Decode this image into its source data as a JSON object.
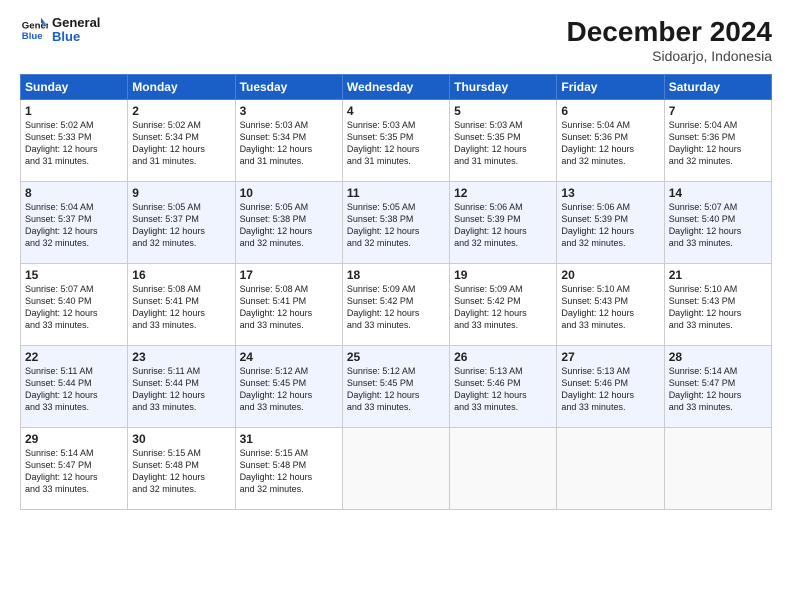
{
  "header": {
    "logo_line1": "General",
    "logo_line2": "Blue",
    "month": "December 2024",
    "location": "Sidoarjo, Indonesia"
  },
  "days_of_week": [
    "Sunday",
    "Monday",
    "Tuesday",
    "Wednesday",
    "Thursday",
    "Friday",
    "Saturday"
  ],
  "weeks": [
    [
      {
        "day": "1",
        "rise": "5:02 AM",
        "set": "5:33 PM",
        "hours": "12",
        "mins": "31"
      },
      {
        "day": "2",
        "rise": "5:02 AM",
        "set": "5:34 PM",
        "hours": "12",
        "mins": "31"
      },
      {
        "day": "3",
        "rise": "5:03 AM",
        "set": "5:34 PM",
        "hours": "12",
        "mins": "31"
      },
      {
        "day": "4",
        "rise": "5:03 AM",
        "set": "5:35 PM",
        "hours": "12",
        "mins": "31"
      },
      {
        "day": "5",
        "rise": "5:03 AM",
        "set": "5:35 PM",
        "hours": "12",
        "mins": "31"
      },
      {
        "day": "6",
        "rise": "5:04 AM",
        "set": "5:36 PM",
        "hours": "12",
        "mins": "32"
      },
      {
        "day": "7",
        "rise": "5:04 AM",
        "set": "5:36 PM",
        "hours": "12",
        "mins": "32"
      }
    ],
    [
      {
        "day": "8",
        "rise": "5:04 AM",
        "set": "5:37 PM",
        "hours": "12",
        "mins": "32"
      },
      {
        "day": "9",
        "rise": "5:05 AM",
        "set": "5:37 PM",
        "hours": "12",
        "mins": "32"
      },
      {
        "day": "10",
        "rise": "5:05 AM",
        "set": "5:38 PM",
        "hours": "12",
        "mins": "32"
      },
      {
        "day": "11",
        "rise": "5:05 AM",
        "set": "5:38 PM",
        "hours": "12",
        "mins": "32"
      },
      {
        "day": "12",
        "rise": "5:06 AM",
        "set": "5:39 PM",
        "hours": "12",
        "mins": "32"
      },
      {
        "day": "13",
        "rise": "5:06 AM",
        "set": "5:39 PM",
        "hours": "12",
        "mins": "32"
      },
      {
        "day": "14",
        "rise": "5:07 AM",
        "set": "5:40 PM",
        "hours": "12",
        "mins": "33"
      }
    ],
    [
      {
        "day": "15",
        "rise": "5:07 AM",
        "set": "5:40 PM",
        "hours": "12",
        "mins": "33"
      },
      {
        "day": "16",
        "rise": "5:08 AM",
        "set": "5:41 PM",
        "hours": "12",
        "mins": "33"
      },
      {
        "day": "17",
        "rise": "5:08 AM",
        "set": "5:41 PM",
        "hours": "12",
        "mins": "33"
      },
      {
        "day": "18",
        "rise": "5:09 AM",
        "set": "5:42 PM",
        "hours": "12",
        "mins": "33"
      },
      {
        "day": "19",
        "rise": "5:09 AM",
        "set": "5:42 PM",
        "hours": "12",
        "mins": "33"
      },
      {
        "day": "20",
        "rise": "5:10 AM",
        "set": "5:43 PM",
        "hours": "12",
        "mins": "33"
      },
      {
        "day": "21",
        "rise": "5:10 AM",
        "set": "5:43 PM",
        "hours": "12",
        "mins": "33"
      }
    ],
    [
      {
        "day": "22",
        "rise": "5:11 AM",
        "set": "5:44 PM",
        "hours": "12",
        "mins": "33"
      },
      {
        "day": "23",
        "rise": "5:11 AM",
        "set": "5:44 PM",
        "hours": "12",
        "mins": "33"
      },
      {
        "day": "24",
        "rise": "5:12 AM",
        "set": "5:45 PM",
        "hours": "12",
        "mins": "33"
      },
      {
        "day": "25",
        "rise": "5:12 AM",
        "set": "5:45 PM",
        "hours": "12",
        "mins": "33"
      },
      {
        "day": "26",
        "rise": "5:13 AM",
        "set": "5:46 PM",
        "hours": "12",
        "mins": "33"
      },
      {
        "day": "27",
        "rise": "5:13 AM",
        "set": "5:46 PM",
        "hours": "12",
        "mins": "33"
      },
      {
        "day": "28",
        "rise": "5:14 AM",
        "set": "5:47 PM",
        "hours": "12",
        "mins": "33"
      }
    ],
    [
      {
        "day": "29",
        "rise": "5:14 AM",
        "set": "5:47 PM",
        "hours": "12",
        "mins": "33"
      },
      {
        "day": "30",
        "rise": "5:15 AM",
        "set": "5:48 PM",
        "hours": "12",
        "mins": "32"
      },
      {
        "day": "31",
        "rise": "5:15 AM",
        "set": "5:48 PM",
        "hours": "12",
        "mins": "32"
      },
      null,
      null,
      null,
      null
    ]
  ]
}
